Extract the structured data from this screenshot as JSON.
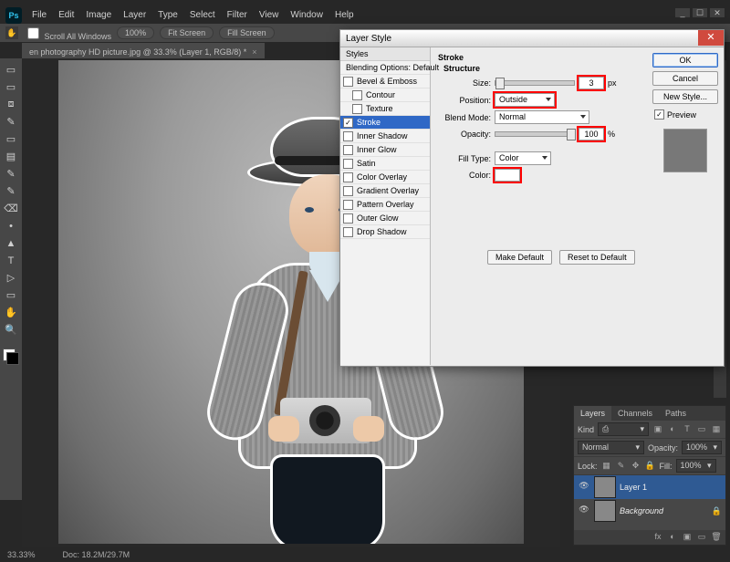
{
  "app": {
    "logo_text": "Ps",
    "menus": [
      "File",
      "Edit",
      "Image",
      "Layer",
      "Type",
      "Select",
      "Filter",
      "View",
      "Window",
      "Help"
    ],
    "window_controls": {
      "min": "_",
      "max": "☐",
      "close": "✕"
    }
  },
  "options_bar": {
    "tool_glyph": "✋",
    "scroll_all": "Scroll All Windows",
    "btn_100": "100%",
    "btn_fit": "Fit Screen",
    "btn_fill": "Fill Screen"
  },
  "doc_tab": {
    "title": "en photography HD picture.jpg @ 33.3% (Layer 1, RGB/8) *",
    "close": "×"
  },
  "tools": [
    "▭",
    "▭",
    "⧈",
    "✎",
    "▭",
    "▤",
    "✎",
    "✎",
    "⌫",
    "•",
    "▲",
    "T",
    "▷",
    "▭",
    "✋",
    "🔍"
  ],
  "statusbar": {
    "zoom": "33.33%",
    "doc": "Doc: 18.2M/29.7M"
  },
  "dialog": {
    "title": "Layer Style",
    "close": "✕",
    "styles_header": "Styles",
    "styles": [
      {
        "label": "Blending Options: Default",
        "checkbox": false,
        "nobox": true
      },
      {
        "label": "Bevel & Emboss",
        "checkbox": false
      },
      {
        "label": "Contour",
        "checkbox": false,
        "indent": true
      },
      {
        "label": "Texture",
        "checkbox": false,
        "indent": true
      },
      {
        "label": "Stroke",
        "checkbox": true,
        "active": true
      },
      {
        "label": "Inner Shadow",
        "checkbox": false
      },
      {
        "label": "Inner Glow",
        "checkbox": false
      },
      {
        "label": "Satin",
        "checkbox": false
      },
      {
        "label": "Color Overlay",
        "checkbox": false
      },
      {
        "label": "Gradient Overlay",
        "checkbox": false
      },
      {
        "label": "Pattern Overlay",
        "checkbox": false
      },
      {
        "label": "Outer Glow",
        "checkbox": false
      },
      {
        "label": "Drop Shadow",
        "checkbox": false
      }
    ],
    "panel": {
      "group": "Stroke",
      "subgroup": "Structure",
      "size_label": "Size:",
      "size_value": "3",
      "size_unit": "px",
      "position_label": "Position:",
      "position_value": "Outside",
      "blend_label": "Blend Mode:",
      "blend_value": "Normal",
      "opacity_label": "Opacity:",
      "opacity_value": "100",
      "opacity_unit": "%",
      "filltype_label": "Fill Type:",
      "filltype_value": "Color",
      "color_label": "Color:",
      "make_default": "Make Default",
      "reset_default": "Reset to Default"
    },
    "buttons": {
      "ok": "OK",
      "cancel": "Cancel",
      "new_style": "New Style...",
      "preview": "Preview"
    }
  },
  "layers_panel": {
    "tabs": [
      "Layers",
      "Channels",
      "Paths"
    ],
    "kind_label": "Kind",
    "kind_value": "⎙",
    "blend_mode": "Normal",
    "opacity_label": "Opacity:",
    "opacity_value": "100%",
    "lock_label": "Lock:",
    "fill_label": "Fill:",
    "fill_value": "100%",
    "layers": [
      {
        "name": "Layer 1",
        "active": true
      },
      {
        "name": "Background",
        "locked": true
      }
    ],
    "footer_icons": [
      "fx",
      "◐",
      "▣",
      "▭",
      "🗑"
    ]
  }
}
